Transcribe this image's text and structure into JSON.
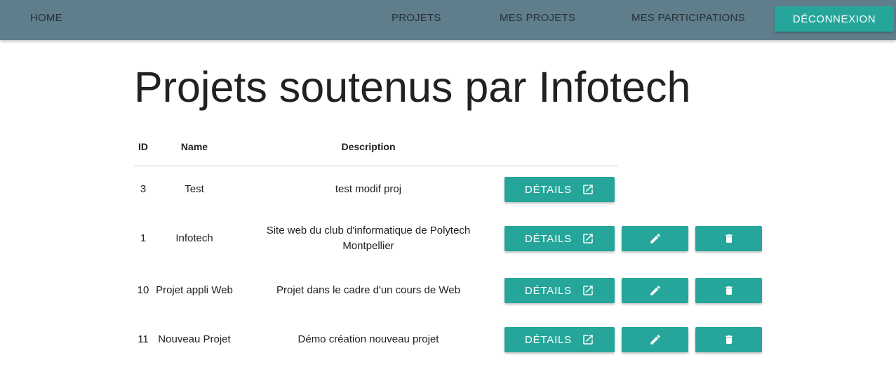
{
  "nav": {
    "home": "HOME",
    "projets": "PROJETS",
    "mes_projets": "MES PROJETS",
    "mes_participations": "MES PARTICIPATIONS",
    "logout": "DÉCONNEXION"
  },
  "page": {
    "title": "Projets soutenus par Infotech"
  },
  "table": {
    "headers": {
      "id": "ID",
      "name": "Name",
      "description": "Description"
    },
    "details_label": "DÉTAILS",
    "rows": [
      {
        "id": "3",
        "name": "Test",
        "description": "test modif proj",
        "editable": false
      },
      {
        "id": "1",
        "name": "Infotech",
        "description": "Site web du club d'informatique de Polytech Montpellier",
        "editable": true
      },
      {
        "id": "10",
        "name": "Projet appli Web",
        "description": "Projet dans le cadre d'un cours de Web",
        "editable": true
      },
      {
        "id": "11",
        "name": "Nouveau Projet",
        "description": "Démo création nouveau projet",
        "editable": true
      }
    ]
  },
  "colors": {
    "navbar": "#607d8b",
    "accent": "#26a69a"
  },
  "icons": {
    "details": "open-in-new-icon",
    "edit": "pencil-icon",
    "delete": "trash-icon"
  }
}
